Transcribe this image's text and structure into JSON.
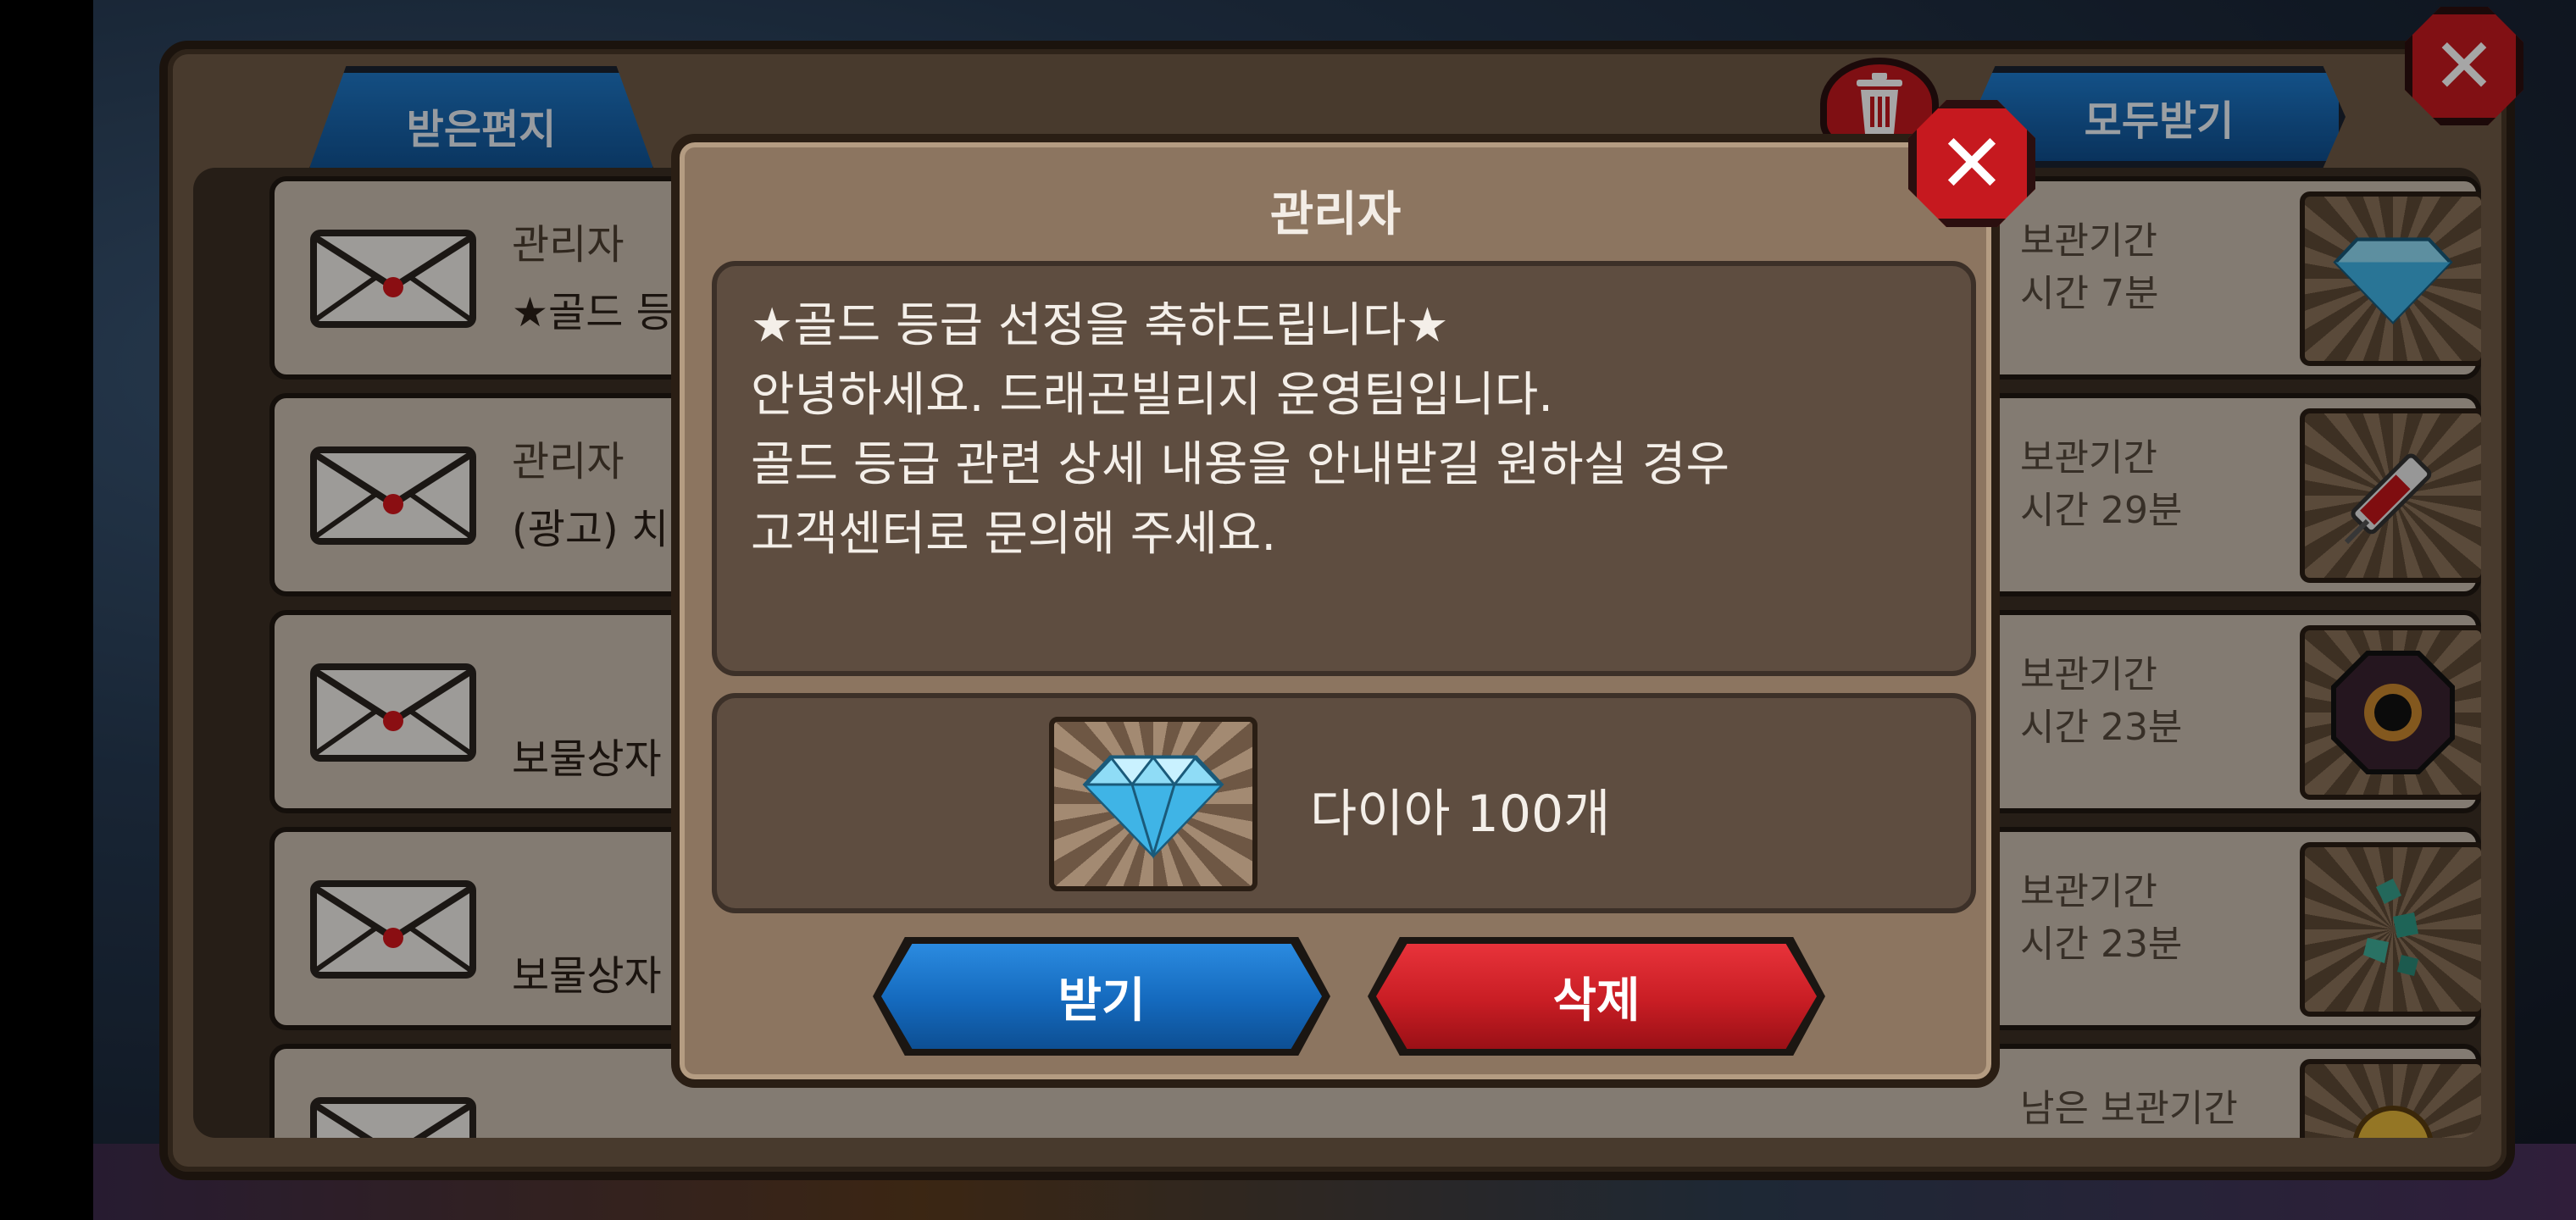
{
  "mailbox": {
    "tab_label": "받은편지",
    "receive_all_label": "모두받기",
    "rows": [
      {
        "sender": "관리자",
        "subject": "★골드 등",
        "expiry_label": "보관기간",
        "expiry_time": "시간 7분",
        "thumb_icon": "diamond-icon"
      },
      {
        "sender": "관리자",
        "subject": "(광고) 치",
        "expiry_label": "보관기간",
        "expiry_time": "시간 29분",
        "thumb_icon": "syringe-icon"
      },
      {
        "sender": "",
        "subject": "보물상자",
        "expiry_label": "보관기간",
        "expiry_time": "시간 23분",
        "thumb_icon": "dark-orb-icon"
      },
      {
        "sender": "",
        "subject": "보물상자",
        "expiry_label": "보관기간",
        "expiry_time": "시간 23분",
        "thumb_icon": "green-gems-icon"
      },
      {
        "sender": "",
        "subject": "",
        "expiry_label": "남은 보관기간",
        "expiry_time": "",
        "thumb_icon": "gold-item-icon"
      }
    ]
  },
  "modal": {
    "title": "관리자",
    "message_lines": [
      "★골드 등급 선정을 축하드립니다★",
      "안녕하세요. 드래곤빌리지 운영팀입니다.",
      "골드 등급 관련 상세 내용을 안내받길 원하실 경우",
      "고객센터로 문의해 주세요."
    ],
    "reward_text": "다이아 100개",
    "reward_icon": "diamond-icon",
    "receive_label": "받기",
    "delete_label": "삭제"
  },
  "colors": {
    "receive_button": "#1469bd",
    "delete_button": "#c81d24",
    "close_button": "#c6191f",
    "panel": "#8c7560"
  }
}
